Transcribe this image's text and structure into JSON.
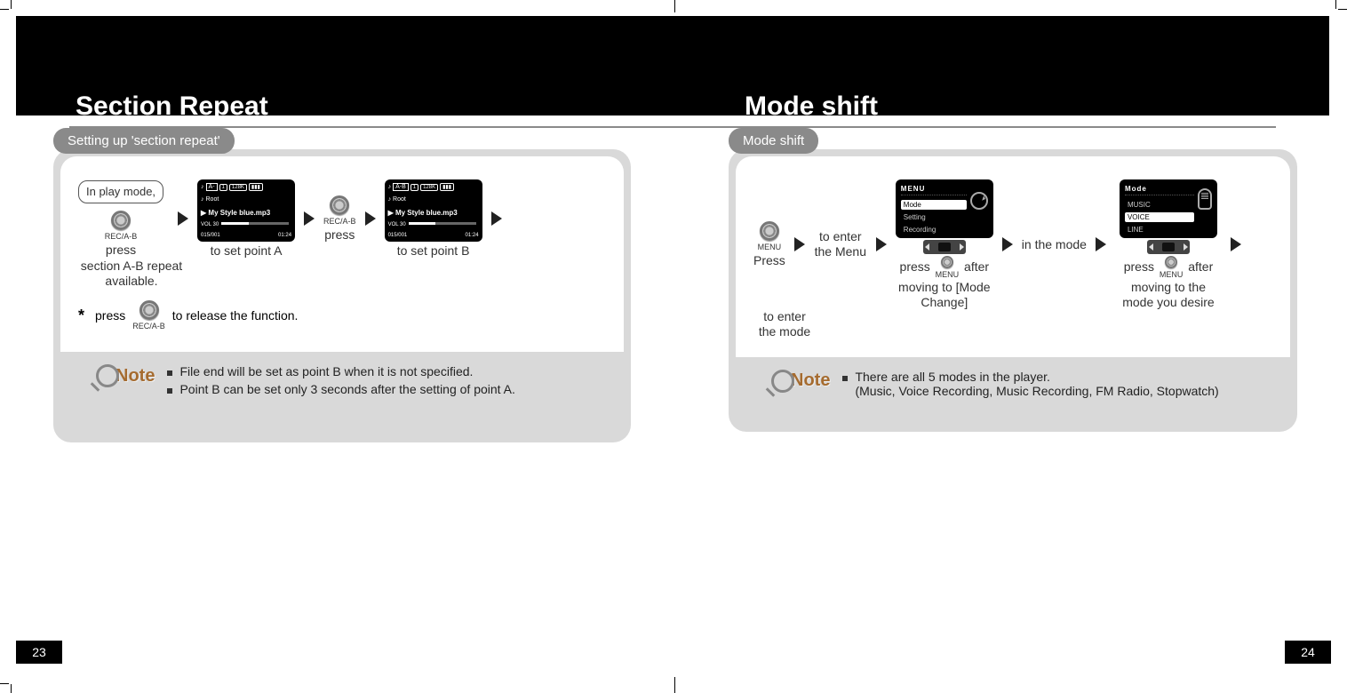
{
  "header": {
    "left_title": "Section Repeat",
    "right_title": "Mode shift"
  },
  "left": {
    "subhead": "Setting up 'section repeat'",
    "badge": "In play mode,",
    "btn_label": "REC/A-B",
    "press": "press",
    "set_a": "to set point A",
    "set_b": "to set point B",
    "avail": "section A-B repeat available.",
    "release": "to release the function.",
    "screen_a": {
      "ab": "A-",
      "bitrate": "128K",
      "folder": "Root",
      "track": "My Style blue.mp3",
      "vol": "VOL 30",
      "idx": "015/001",
      "time": "01:24"
    },
    "screen_b": {
      "ab": "A-B",
      "bitrate": "128K",
      "folder": "Root",
      "track": "My Style blue.mp3",
      "vol": "VOL 30",
      "idx": "015/001",
      "time": "01:24"
    },
    "note_label": "Note",
    "note_items": [
      "File end will be set as point B when it is not specified.",
      "Point B can be set only 3 seconds after the setting of point A."
    ]
  },
  "right": {
    "subhead": "Mode shift",
    "menu_btn_label": "MENU",
    "press_cap": "Press",
    "enter_menu": "to enter the Menu",
    "press_after1": "press",
    "after1": "after moving to [Mode Change]",
    "in_mode": "in the mode",
    "press_after2": "press",
    "after2": "after moving to the mode you desire",
    "enter_mode": "to enter the mode",
    "menu1": {
      "head": "MENU",
      "items": [
        "Mode",
        "Setting",
        "Recording"
      ],
      "sel": 0
    },
    "menu2": {
      "head": "Mode",
      "items": [
        "MUSIC",
        "VOICE",
        "LINE"
      ],
      "sel": 1
    },
    "note_label": "Note",
    "note_items": [
      "There are all 5 modes in the player.\n(Music, Voice Recording, Music Recording, FM Radio, Stopwatch)"
    ]
  },
  "pages": {
    "left": "23",
    "right": "24"
  }
}
